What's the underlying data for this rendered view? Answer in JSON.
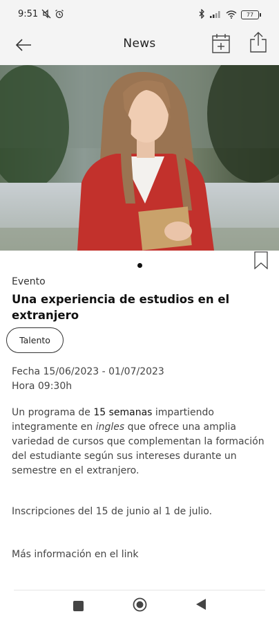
{
  "status_bar": {
    "time": "9:51",
    "left_icons": [
      "mute-icon",
      "alarm-icon"
    ],
    "right_icons": [
      "bluetooth-icon",
      "signal-icon",
      "wifi-icon",
      "battery-icon"
    ],
    "battery": "77"
  },
  "app_bar": {
    "title": "News",
    "back_icon": "arrow-left-icon",
    "calendar_icon": "calendar-add-icon",
    "share_icon": "share-icon"
  },
  "hero": {
    "image": "photo of a young woman in a red coat holding a notebook outdoors",
    "active_slide": 1,
    "slides": 1
  },
  "article": {
    "category": "Evento",
    "title": "Una experiencia de estudios en el extranjero",
    "tag": "Talento",
    "date_line": "Fecha 15/06/2023 - 01/07/2023",
    "time_line": "Hora 09:30h",
    "body": {
      "part1": "Un programa de ",
      "highlight1": "15 semanas",
      "part2": " impartiendo integramente en ",
      "highlight2": "ingles",
      "part3": " que ofrece una amplia variedad de cursos que complementan la formación del estudiante según sus intereses durante un semestre en el extranjero."
    },
    "registration": "Inscripciones del 15 de junio al 1 de julio.",
    "more_info": "Más información en el link"
  },
  "colors": {
    "appbar_bg": "#f4f4f4",
    "text_dark": "#111111",
    "text_body": "#444444"
  }
}
